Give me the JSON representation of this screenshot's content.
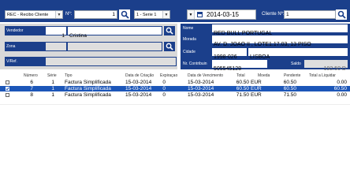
{
  "top": {
    "type_select": "REC - Recibo Cliente",
    "nr_label": "Nº:",
    "nr_value": "1",
    "series_select": "1 - Serie 1",
    "date_value": "2014-03-15",
    "cliente_label": "Cliente Nº:",
    "cliente_value": "1"
  },
  "left": {
    "vendedor_label": "Vendedor",
    "vendedor_nr": "1",
    "vendedor_name": "Cristina",
    "zona_label": "Zona",
    "vref_label": "V/Ref."
  },
  "right": {
    "nome_label": "Nome",
    "nome_value": "RED BULL PORTUGAL",
    "morada_label": "Morada",
    "morada_value": "AV. D. JOAO II , LOTE1.17.03, 13 PISO",
    "cidade_label": "Cidade",
    "cidade_code": "1998-026",
    "cidade_name": "LISBOA",
    "contrib_label": "Nr. Contribuin",
    "contrib_value": "505545128",
    "saldo_label": "Saldo",
    "saldo_value": "192.50 D"
  },
  "table": {
    "headers": [
      "Número",
      "Série",
      "Tipo",
      "Data de Criação",
      "Expiraçao",
      "Data de Vencimento",
      "Total",
      "Moeda",
      "Pendente",
      "Total a Liquidar"
    ],
    "rows": [
      {
        "checked": false,
        "numero": "6",
        "serie": "1",
        "tipo": "Factura Simplificada",
        "data": "15-03-2014",
        "exp": "0",
        "venc": "15-03-2014",
        "total": "60.50",
        "moeda": "EUR",
        "pendente": "60.50",
        "liquidar": "0.00"
      },
      {
        "checked": true,
        "numero": "7",
        "serie": "1",
        "tipo": "Factura Simplificada",
        "data": "15-03-2014",
        "exp": "0",
        "venc": "15-03-2014",
        "total": "60.50",
        "moeda": "EUR",
        "pendente": "60.50",
        "liquidar": "60.50"
      },
      {
        "checked": false,
        "numero": "8",
        "serie": "1",
        "tipo": "Factura Simplificada",
        "data": "15-03-2014",
        "exp": "0",
        "venc": "15-03-2014",
        "total": "71.50",
        "moeda": "EUR",
        "pendente": "71.50",
        "liquidar": "0.00"
      }
    ]
  },
  "colors": {
    "dark_blue": "#1b3f8b",
    "selected_row": "#1c56b8",
    "panel_gray": "#d9d9d9"
  }
}
